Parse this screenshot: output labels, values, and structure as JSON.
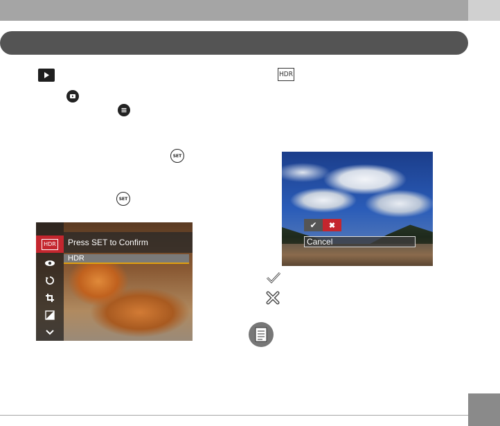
{
  "icons": {
    "play": "play-icon",
    "hdr": "hdr-icon",
    "playback_button": "playback-button-icon",
    "menu_button": "menu-button-icon",
    "set_button": "set-button-icon",
    "check": "check-icon",
    "cross": "cross-icon",
    "note": "note-icon"
  },
  "icon_labels": {
    "set": "SET",
    "hdr": "HDR",
    "check": "✔",
    "cross": "✖"
  },
  "screen_left": {
    "menu_title": "Press SET to Confirm",
    "selected_option": "HDR",
    "side_items": [
      "HDR",
      "red-eye-icon",
      "rotate-icon",
      "crop-icon",
      "exposure-icon",
      "chevron-down-icon"
    ]
  },
  "screen_right": {
    "ok_symbol": "✔",
    "cancel_symbol": "✖",
    "cancel_label": "Cancel"
  },
  "colors": {
    "accent_red": "#c4262e",
    "header_gray": "#a5a5a5",
    "pill_dark": "#545454",
    "highlight": "#e0a010"
  }
}
